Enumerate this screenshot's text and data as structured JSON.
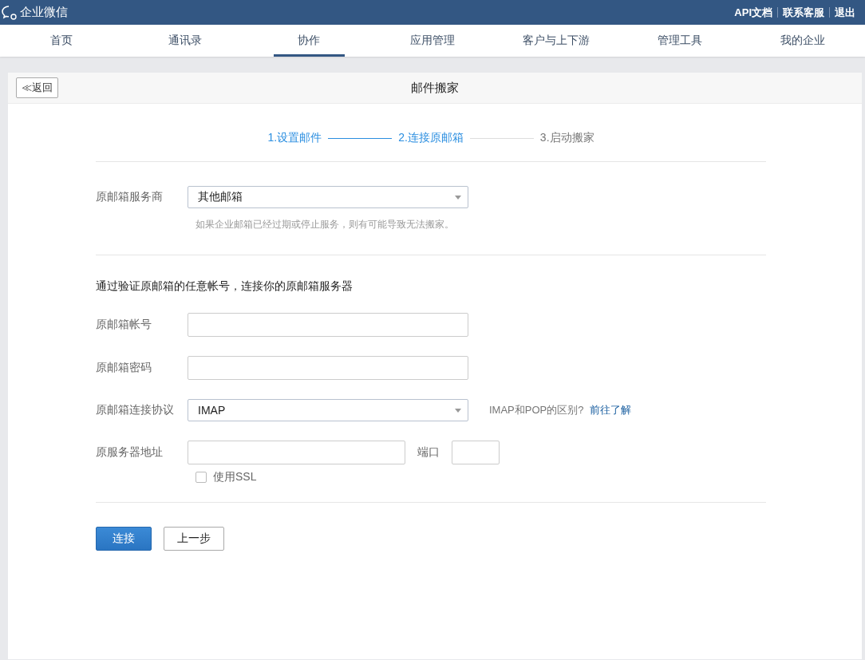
{
  "top_bar": {
    "brand": "企业微信",
    "links": [
      "API文档",
      "联系客服",
      "退出"
    ]
  },
  "nav_tabs": [
    {
      "label": "首页",
      "selected": false
    },
    {
      "label": "通讯录",
      "selected": false
    },
    {
      "label": "协作",
      "selected": true
    },
    {
      "label": "应用管理",
      "selected": false
    },
    {
      "label": "客户与上下游",
      "selected": false
    },
    {
      "label": "管理工具",
      "selected": false
    },
    {
      "label": "我的企业",
      "selected": false
    }
  ],
  "header": {
    "back_button": {
      "icon": "≪",
      "label": "返回"
    },
    "title": "邮件搬家"
  },
  "steps": [
    {
      "label": "1.设置邮件",
      "active": true
    },
    {
      "label": "2.连接原邮箱",
      "active": true
    },
    {
      "label": "3.启动搬家",
      "active": false
    }
  ],
  "provider": {
    "label": "原邮箱服务商",
    "value": "其他邮箱",
    "hint": "如果企业邮箱已经过期或停止服务，则有可能导致无法搬家。"
  },
  "intro": "通过验证原邮箱的任意帐号，连接你的原邮箱服务器",
  "account": {
    "label": "原邮箱帐号"
  },
  "password": {
    "label": "原邮箱密码"
  },
  "protocol": {
    "label": "原邮箱连接协议",
    "value": "IMAP",
    "help": "IMAP和POP的区别?",
    "link": "前往了解"
  },
  "server": {
    "label": "原服务器地址",
    "port_label": "端口",
    "ssl": {
      "label": "使用SSL",
      "checked": false
    }
  },
  "buttons": {
    "primary": "连接",
    "secondary": "上一步"
  }
}
